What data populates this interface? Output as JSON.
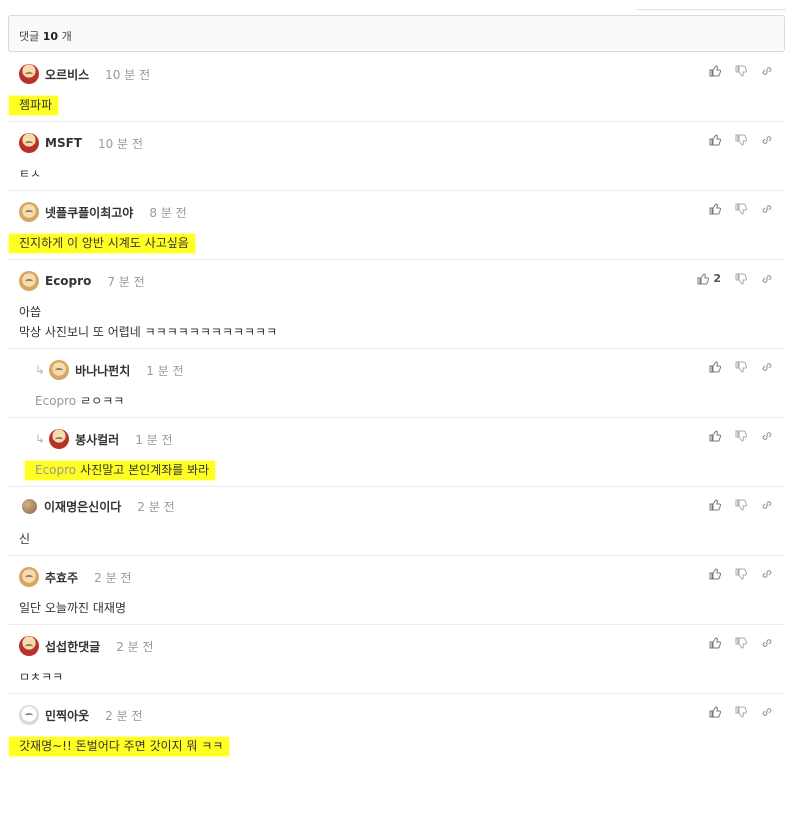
{
  "header": {
    "label": "댓글",
    "count": "10",
    "unit": "개"
  },
  "comments": [
    {
      "user": "오르비스",
      "time": "10 분 전",
      "avatar": "dog-red-icon",
      "text": "젬파파",
      "highlight": true,
      "likes": ""
    },
    {
      "user": "MSFT",
      "time": "10 분 전",
      "avatar": "dog-red-icon",
      "text": "ㅌㅅ",
      "highlight": false,
      "likes": ""
    },
    {
      "user": "넷플쿠플이최고야",
      "time": "8 분 전",
      "avatar": "dog-icon",
      "text": "진지하게 이 앙반 시계도 사고싶음",
      "highlight": true,
      "likes": ""
    },
    {
      "user": "Ecopro",
      "time": "7 분 전",
      "avatar": "dog-icon",
      "text_line1": "아씁",
      "text_line2": "막상 사진보니 또 어렵네 ㅋㅋㅋㅋㅋㅋㅋㅋㅋㅋㅋㅋ",
      "likes": "2"
    },
    {
      "user": "바나나펀치",
      "time": "1 분 전",
      "avatar": "dog-icon",
      "mention": "Ecopro",
      "text": "ㄹㅇㅋㅋ",
      "reply": true,
      "likes": ""
    },
    {
      "user": "봉사컬러",
      "time": "1 분 전",
      "avatar": "dog-red-icon",
      "mention": "Ecopro",
      "text": "사진말고 본인계좌를 봐라",
      "reply": true,
      "highlight": true,
      "likes": ""
    },
    {
      "user": "이재명은신이다",
      "time": "2 분 전",
      "avatar": "ball-icon",
      "text": "신",
      "likes": ""
    },
    {
      "user": "추효주",
      "time": "2 분 전",
      "avatar": "dog-icon",
      "text": "일단 오늘까진 대재명",
      "likes": ""
    },
    {
      "user": "섭섭한댓글",
      "time": "2 분 전",
      "avatar": "dog-red-icon",
      "text": "ㅁㅊㅋㅋ",
      "likes": ""
    },
    {
      "user": "민찍아웃",
      "time": "2 분 전",
      "avatar": "white-dog-icon",
      "text": "갓재명~!! 돈벌어다 주면 갓이지 뭐 ㅋㅋ",
      "highlight": true,
      "likes": ""
    }
  ],
  "icons": {
    "like": "thumbs-up-icon",
    "dislike": "thumbs-down-icon",
    "share": "link-icon"
  },
  "colors": {
    "highlight": "#ffff24",
    "muted": "#999999",
    "border": "#d9d9d9"
  }
}
